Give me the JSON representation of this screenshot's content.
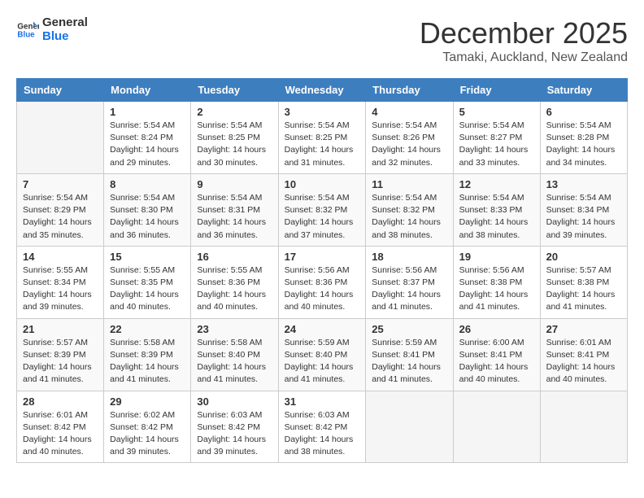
{
  "header": {
    "logo_general": "General",
    "logo_blue": "Blue",
    "month": "December 2025",
    "location": "Tamaki, Auckland, New Zealand"
  },
  "days_of_week": [
    "Sunday",
    "Monday",
    "Tuesday",
    "Wednesday",
    "Thursday",
    "Friday",
    "Saturday"
  ],
  "weeks": [
    [
      {
        "day": "",
        "info": ""
      },
      {
        "day": "1",
        "info": "Sunrise: 5:54 AM\nSunset: 8:24 PM\nDaylight: 14 hours\nand 29 minutes."
      },
      {
        "day": "2",
        "info": "Sunrise: 5:54 AM\nSunset: 8:25 PM\nDaylight: 14 hours\nand 30 minutes."
      },
      {
        "day": "3",
        "info": "Sunrise: 5:54 AM\nSunset: 8:25 PM\nDaylight: 14 hours\nand 31 minutes."
      },
      {
        "day": "4",
        "info": "Sunrise: 5:54 AM\nSunset: 8:26 PM\nDaylight: 14 hours\nand 32 minutes."
      },
      {
        "day": "5",
        "info": "Sunrise: 5:54 AM\nSunset: 8:27 PM\nDaylight: 14 hours\nand 33 minutes."
      },
      {
        "day": "6",
        "info": "Sunrise: 5:54 AM\nSunset: 8:28 PM\nDaylight: 14 hours\nand 34 minutes."
      }
    ],
    [
      {
        "day": "7",
        "info": "Sunrise: 5:54 AM\nSunset: 8:29 PM\nDaylight: 14 hours\nand 35 minutes."
      },
      {
        "day": "8",
        "info": "Sunrise: 5:54 AM\nSunset: 8:30 PM\nDaylight: 14 hours\nand 36 minutes."
      },
      {
        "day": "9",
        "info": "Sunrise: 5:54 AM\nSunset: 8:31 PM\nDaylight: 14 hours\nand 36 minutes."
      },
      {
        "day": "10",
        "info": "Sunrise: 5:54 AM\nSunset: 8:32 PM\nDaylight: 14 hours\nand 37 minutes."
      },
      {
        "day": "11",
        "info": "Sunrise: 5:54 AM\nSunset: 8:32 PM\nDaylight: 14 hours\nand 38 minutes."
      },
      {
        "day": "12",
        "info": "Sunrise: 5:54 AM\nSunset: 8:33 PM\nDaylight: 14 hours\nand 38 minutes."
      },
      {
        "day": "13",
        "info": "Sunrise: 5:54 AM\nSunset: 8:34 PM\nDaylight: 14 hours\nand 39 minutes."
      }
    ],
    [
      {
        "day": "14",
        "info": "Sunrise: 5:55 AM\nSunset: 8:34 PM\nDaylight: 14 hours\nand 39 minutes."
      },
      {
        "day": "15",
        "info": "Sunrise: 5:55 AM\nSunset: 8:35 PM\nDaylight: 14 hours\nand 40 minutes."
      },
      {
        "day": "16",
        "info": "Sunrise: 5:55 AM\nSunset: 8:36 PM\nDaylight: 14 hours\nand 40 minutes."
      },
      {
        "day": "17",
        "info": "Sunrise: 5:56 AM\nSunset: 8:36 PM\nDaylight: 14 hours\nand 40 minutes."
      },
      {
        "day": "18",
        "info": "Sunrise: 5:56 AM\nSunset: 8:37 PM\nDaylight: 14 hours\nand 41 minutes."
      },
      {
        "day": "19",
        "info": "Sunrise: 5:56 AM\nSunset: 8:38 PM\nDaylight: 14 hours\nand 41 minutes."
      },
      {
        "day": "20",
        "info": "Sunrise: 5:57 AM\nSunset: 8:38 PM\nDaylight: 14 hours\nand 41 minutes."
      }
    ],
    [
      {
        "day": "21",
        "info": "Sunrise: 5:57 AM\nSunset: 8:39 PM\nDaylight: 14 hours\nand 41 minutes."
      },
      {
        "day": "22",
        "info": "Sunrise: 5:58 AM\nSunset: 8:39 PM\nDaylight: 14 hours\nand 41 minutes."
      },
      {
        "day": "23",
        "info": "Sunrise: 5:58 AM\nSunset: 8:40 PM\nDaylight: 14 hours\nand 41 minutes."
      },
      {
        "day": "24",
        "info": "Sunrise: 5:59 AM\nSunset: 8:40 PM\nDaylight: 14 hours\nand 41 minutes."
      },
      {
        "day": "25",
        "info": "Sunrise: 5:59 AM\nSunset: 8:41 PM\nDaylight: 14 hours\nand 41 minutes."
      },
      {
        "day": "26",
        "info": "Sunrise: 6:00 AM\nSunset: 8:41 PM\nDaylight: 14 hours\nand 40 minutes."
      },
      {
        "day": "27",
        "info": "Sunrise: 6:01 AM\nSunset: 8:41 PM\nDaylight: 14 hours\nand 40 minutes."
      }
    ],
    [
      {
        "day": "28",
        "info": "Sunrise: 6:01 AM\nSunset: 8:42 PM\nDaylight: 14 hours\nand 40 minutes."
      },
      {
        "day": "29",
        "info": "Sunrise: 6:02 AM\nSunset: 8:42 PM\nDaylight: 14 hours\nand 39 minutes."
      },
      {
        "day": "30",
        "info": "Sunrise: 6:03 AM\nSunset: 8:42 PM\nDaylight: 14 hours\nand 39 minutes."
      },
      {
        "day": "31",
        "info": "Sunrise: 6:03 AM\nSunset: 8:42 PM\nDaylight: 14 hours\nand 38 minutes."
      },
      {
        "day": "",
        "info": ""
      },
      {
        "day": "",
        "info": ""
      },
      {
        "day": "",
        "info": ""
      }
    ]
  ]
}
